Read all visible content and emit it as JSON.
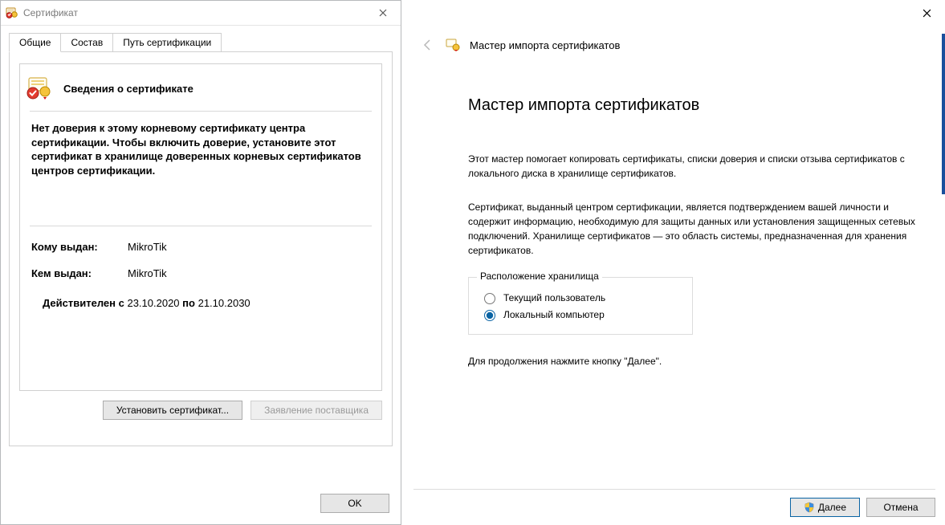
{
  "cert_dialog": {
    "title": "Сертификат",
    "tabs": [
      "Общие",
      "Состав",
      "Путь сертификации"
    ],
    "info_heading": "Сведения о сертификате",
    "trust_warning": "Нет доверия к этому корневому сертификату центра сертификации. Чтобы включить доверие, установите этот сертификат в хранилище доверенных корневых сертификатов центров сертификации.",
    "issued_to_label": "Кому выдан:",
    "issued_to_value": "MikroTik",
    "issued_by_label": "Кем выдан:",
    "issued_by_value": "MikroTik",
    "valid_prefix": "Действителен с",
    "valid_from": "23.10.2020",
    "valid_mid": "по",
    "valid_to": "21.10.2030",
    "install_button": "Установить сертификат...",
    "statement_button": "Заявление поставщика",
    "ok_button": "OK"
  },
  "wizard": {
    "header_title": "Мастер импорта сертификатов",
    "main_title": "Мастер импорта сертификатов",
    "para1": "Этот мастер помогает копировать сертификаты, списки доверия и списки отзыва сертификатов с локального диска в хранилище сертификатов.",
    "para2": "Сертификат, выданный центром сертификации, является подтверждением вашей личности и содержит информацию, необходимую для защиты данных или установления защищенных сетевых подключений. Хранилище сертификатов — это область системы, предназначенная для хранения сертификатов.",
    "group_legend": "Расположение хранилища",
    "radio_current_user": "Текущий пользователь",
    "radio_local_machine": "Локальный компьютер",
    "continue_text": "Для продолжения нажмите кнопку \"Далее\".",
    "next_button": "Далее",
    "cancel_button": "Отмена"
  }
}
